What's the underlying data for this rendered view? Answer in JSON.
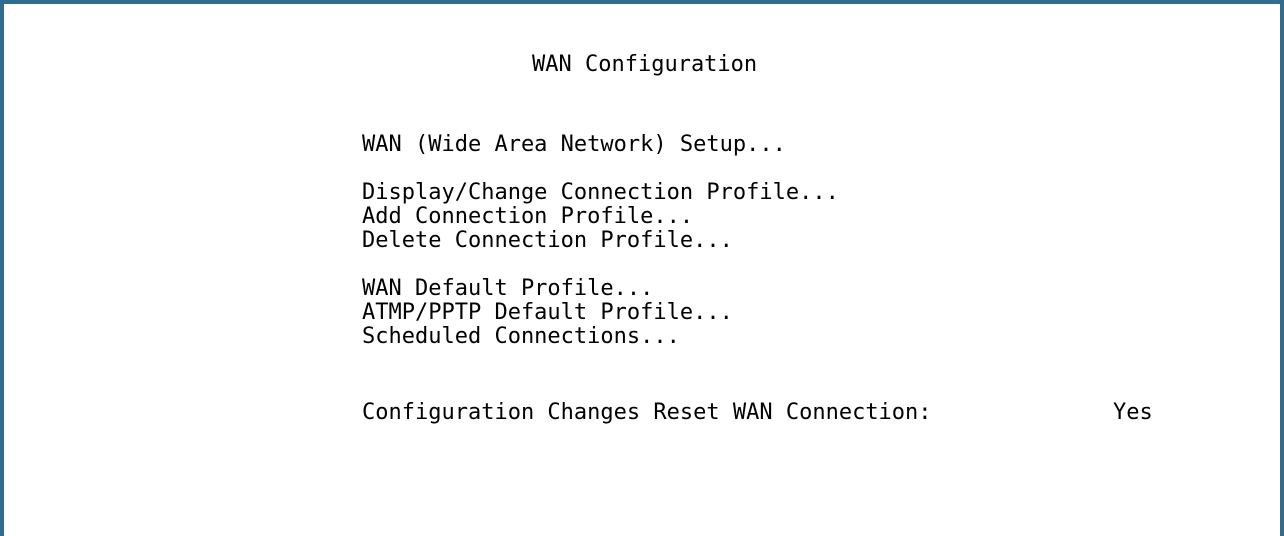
{
  "screen": {
    "title": "WAN Configuration"
  },
  "menu": {
    "items": [
      {
        "label": "WAN (Wide Area Network) Setup..."
      },
      {
        "label": "Display/Change Connection Profile..."
      },
      {
        "label": "Add Connection Profile..."
      },
      {
        "label": "Delete Connection Profile..."
      },
      {
        "label": "WAN Default Profile..."
      },
      {
        "label": "ATMP/PPTP Default Profile..."
      },
      {
        "label": "Scheduled Connections..."
      }
    ]
  },
  "setting": {
    "label": "Configuration Changes Reset WAN Connection:",
    "value": "Yes"
  },
  "colors": {
    "frame_border": "#336b8e",
    "background": "#ffffff",
    "text": "#000000"
  }
}
